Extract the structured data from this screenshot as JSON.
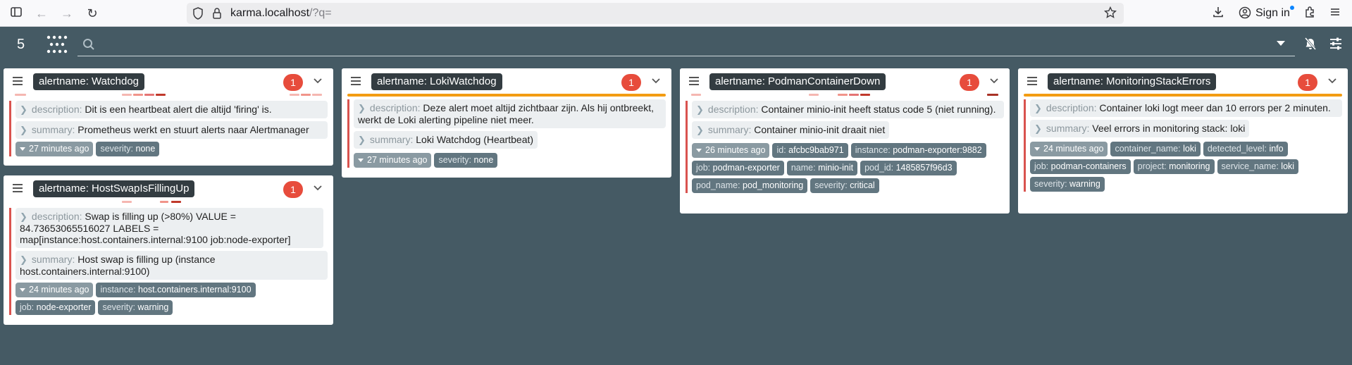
{
  "browser": {
    "url_host": "karma.localhost",
    "url_rest": "/?q=",
    "signin_label": "Sign in"
  },
  "navbar": {
    "alert_count": "5",
    "search_value": ""
  },
  "colors": {
    "background": "#455a64",
    "badge": "#e74c3c",
    "label": "#627680",
    "orange_bar": "#f39c12",
    "alert_border": "#d9534f"
  },
  "groups": [
    {
      "name": "alertname: Watchdog",
      "count": "1",
      "description_key": "description:",
      "description": "Dit is een heartbeat alert die altijd 'firing' is.",
      "summary_key": "summary:",
      "summary": "Prometheus werkt en stuurt alerts naar Alertmanager",
      "time": "27 minutes ago",
      "labels": [
        {
          "k": "severity:",
          "v": "none"
        }
      ]
    },
    {
      "name": "alertname: LokiWatchdog",
      "count": "1",
      "description_key": "description:",
      "description": "Deze alert moet altijd zichtbaar zijn. Als hij ontbreekt, werkt de Loki alerting pipeline niet meer.",
      "summary_key": "summary:",
      "summary": "Loki Watchdog (Heartbeat)",
      "time": "27 minutes ago",
      "labels": [
        {
          "k": "severity:",
          "v": "none"
        }
      ]
    },
    {
      "name": "alertname: PodmanContainerDown",
      "count": "1",
      "description_key": "description:",
      "description": "Container minio-init heeft status code 5 (niet running).",
      "summary_key": "summary:",
      "summary": "Container minio-init draait niet",
      "time": "26 minutes ago",
      "labels": [
        {
          "k": "id:",
          "v": "afcbc9bab971"
        },
        {
          "k": "instance:",
          "v": "podman-exporter:9882"
        },
        {
          "k": "job:",
          "v": "podman-exporter"
        },
        {
          "k": "name:",
          "v": "minio-init"
        },
        {
          "k": "pod_id:",
          "v": "1485857f96d3"
        },
        {
          "k": "pod_name:",
          "v": "pod_monitoring"
        },
        {
          "k": "severity:",
          "v": "critical"
        }
      ]
    },
    {
      "name": "alertname: MonitoringStackErrors",
      "count": "1",
      "description_key": "description:",
      "description": "Container loki logt meer dan 10 errors per 2 minuten.",
      "summary_key": "summary:",
      "summary": "Veel errors in monitoring stack: loki",
      "time": "24 minutes ago",
      "labels": [
        {
          "k": "container_name:",
          "v": "loki"
        },
        {
          "k": "detected_level:",
          "v": "info"
        },
        {
          "k": "job:",
          "v": "podman-containers"
        },
        {
          "k": "project:",
          "v": "monitoring"
        },
        {
          "k": "service_name:",
          "v": "loki"
        },
        {
          "k": "severity:",
          "v": "warning"
        }
      ]
    },
    {
      "name": "alertname: HostSwapIsFillingUp",
      "count": "1",
      "description_key": "description:",
      "description": "Swap is filling up (>80%) VALUE = 84.73653065516027 LABELS = map[instance:host.containers.internal:9100 job:node-exporter]",
      "summary_key": "summary:",
      "summary": "Host swap is filling up (instance host.containers.internal:9100)",
      "time": "24 minutes ago",
      "labels": [
        {
          "k": "instance:",
          "v": "host.containers.internal:9100"
        },
        {
          "k": "job:",
          "v": "node-exporter"
        },
        {
          "k": "severity:",
          "v": "warning"
        }
      ]
    }
  ]
}
